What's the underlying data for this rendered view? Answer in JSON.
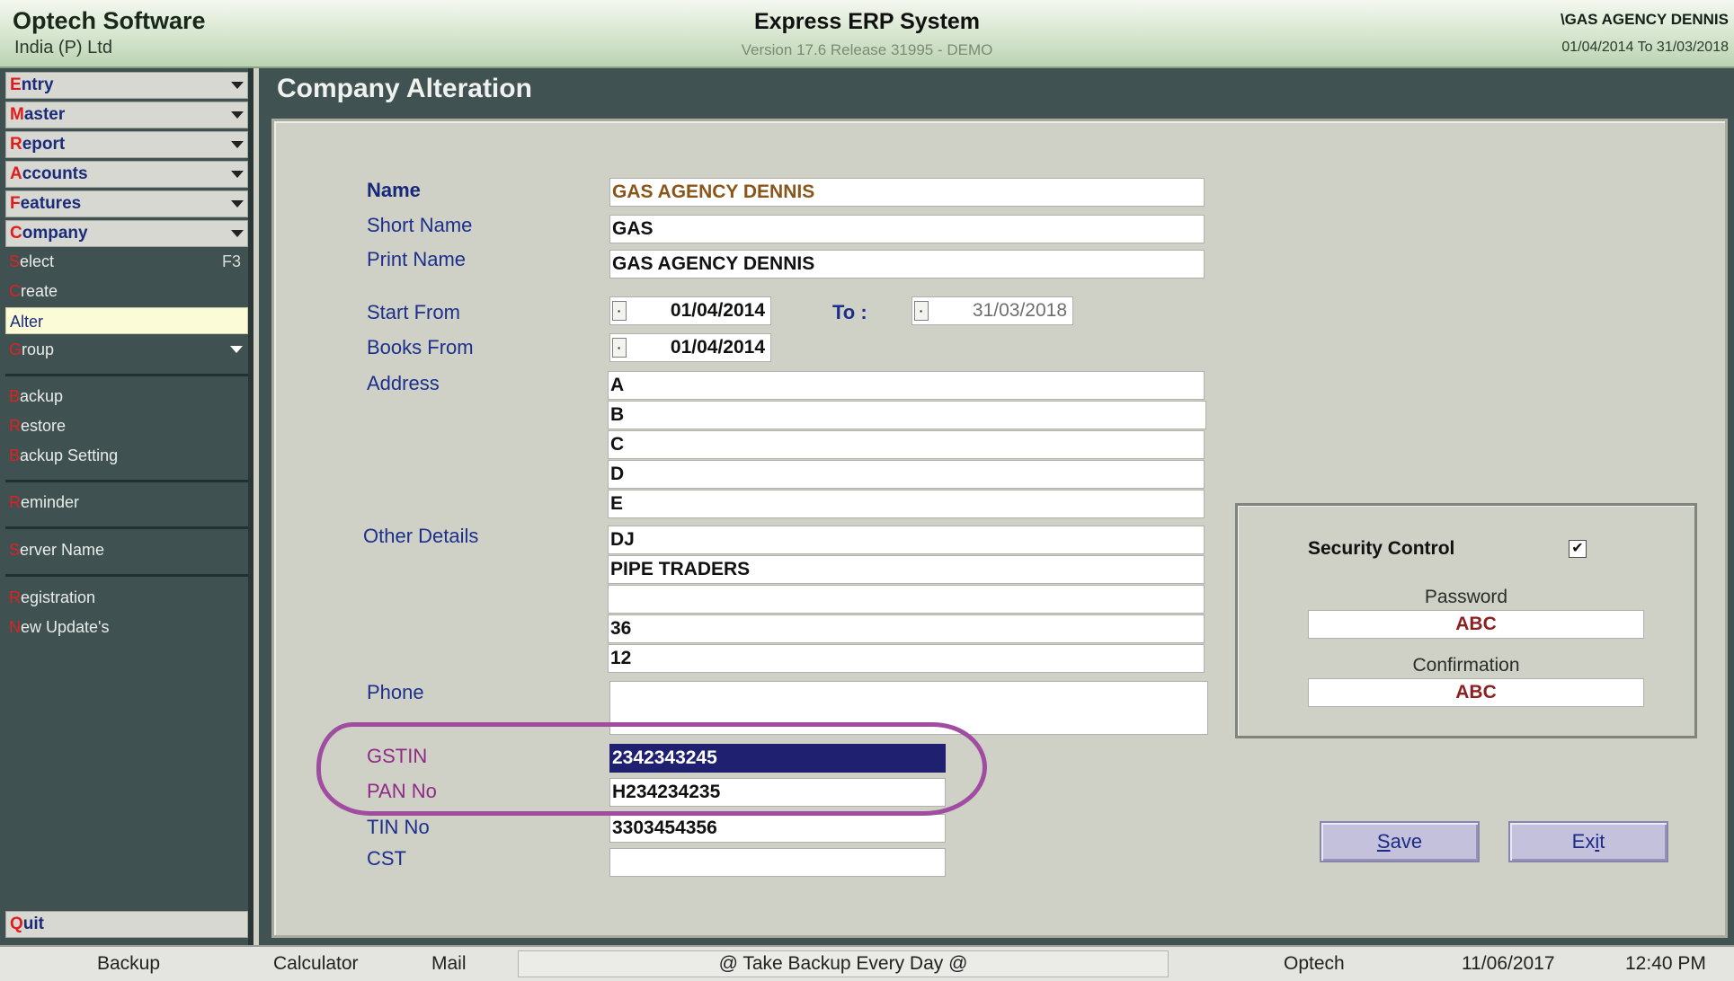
{
  "header": {
    "brand_name": "Optech Software",
    "brand_sub": "India (P) Ltd",
    "system_title": "Express ERP System",
    "version": "Version 17.6 Release 31995 - DEMO",
    "company": "\\GAS AGENCY DENNIS",
    "period": "01/04/2014 To 31/03/2018"
  },
  "sidebar": {
    "menus": [
      {
        "first": "E",
        "rest": "ntry"
      },
      {
        "first": "M",
        "rest": "aster"
      },
      {
        "first": "R",
        "rest": "eport"
      },
      {
        "first": "A",
        "rest": "ccounts"
      },
      {
        "first": "F",
        "rest": "eatures"
      },
      {
        "first": "C",
        "rest": "ompany"
      }
    ],
    "subitems": [
      {
        "first": "S",
        "rest": "elect",
        "key": "F3"
      },
      {
        "first": "C",
        "rest": "reate"
      },
      {
        "first": "A",
        "rest": "lter"
      },
      {
        "first": "G",
        "rest": "roup"
      },
      {
        "first": "B",
        "rest": "ackup"
      },
      {
        "first": "R",
        "rest": "estore"
      },
      {
        "first": "B",
        "rest": "ackup Setting"
      },
      {
        "first": "R",
        "rest": "eminder"
      },
      {
        "first": "S",
        "rest": "erver Name"
      },
      {
        "first": "R",
        "rest": "egistration"
      },
      {
        "first": "N",
        "rest": "ew Update's"
      }
    ],
    "quit": {
      "first": "Q",
      "rest": "uit"
    }
  },
  "form": {
    "title": "Company Alteration",
    "labels": {
      "name": "Name",
      "short_name": "Short Name",
      "print_name": "Print Name",
      "start_from": "Start From",
      "to": "To :",
      "books_from": "Books From",
      "address": "Address",
      "other_details": "Other Details",
      "phone": "Phone",
      "gstin": "GSTIN",
      "pan": "PAN No",
      "tin": "TIN No",
      "cst": "CST"
    },
    "values": {
      "name": "GAS AGENCY DENNIS",
      "short_name": "GAS",
      "print_name": "GAS AGENCY DENNIS",
      "start_from": "01/04/2014",
      "to_date": "31/03/2018",
      "books_from": "01/04/2014",
      "address": [
        "A",
        "B",
        "C",
        "D",
        "E"
      ],
      "other_details": [
        "DJ",
        "PIPE TRADERS",
        "",
        "36",
        "12"
      ],
      "phone": "",
      "gstin": "2342343245",
      "pan": "H234234235",
      "tin": "3303454356",
      "cst": ""
    }
  },
  "security": {
    "title": "Security Control",
    "checked": "✔",
    "password_label": "Password",
    "password_value": "ABC",
    "confirmation_label": "Confirmation",
    "confirmation_value": "ABC"
  },
  "buttons": {
    "save": {
      "mnemonic": "S",
      "rest": "ave"
    },
    "exit": {
      "pre": "Ex",
      "mnemonic": "i",
      "rest": "t"
    }
  },
  "status": {
    "backup": "Backup",
    "calculator": "Calculator",
    "mail": "Mail",
    "message": "@ Take Backup Every Day @",
    "vendor": "Optech",
    "date": "11/06/2017",
    "time": "12:40 PM"
  }
}
